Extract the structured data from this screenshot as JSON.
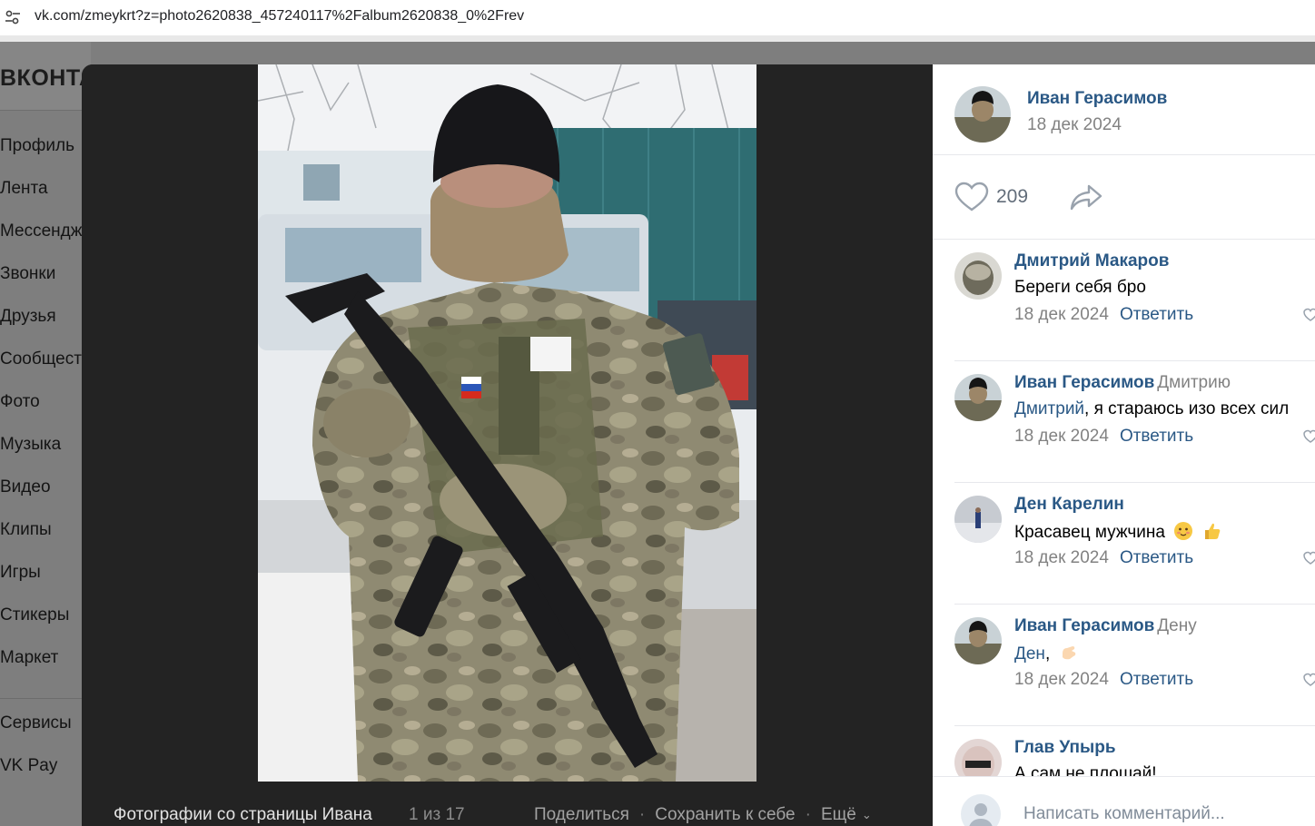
{
  "browser": {
    "url": "vk.com/zmeykrt?z=photo2620838_457240117%2Falbum2620838_0%2Frev",
    "site_icon": "tune-icon"
  },
  "vk": {
    "logo": "ВКОНТАКТЕ",
    "nav": [
      "Профиль",
      "Лента",
      "Мессенджер",
      "Звонки",
      "Друзья",
      "Сообщества",
      "Фото",
      "Музыка",
      "Видео",
      "Клипы",
      "Игры",
      "Стикеры",
      "Маркет"
    ],
    "nav_bottom": [
      "Сервисы",
      "VK Pay"
    ]
  },
  "viewer": {
    "album_title": "Фотографии со страницы Ивана",
    "counter": "1 из 17",
    "share": "Поделиться",
    "save": "Сохранить к себе",
    "more": "Ещё"
  },
  "panel": {
    "author_name": "Иван Герасимов",
    "author_date": "18 дек 2024",
    "likes": "209",
    "reply_label": "Ответить",
    "comment_placeholder": "Написать комментарий..."
  },
  "comments": [
    {
      "author": "Дмитрий Макаров",
      "to": "",
      "mention": "",
      "text": "Береги себя бро",
      "date": "18 дек 2024"
    },
    {
      "author": "Иван Герасимов",
      "to": "Дмитрию",
      "mention": "Дмитрий",
      "text": ", я стараюсь изо всех сил",
      "date": "18 дек 2024"
    },
    {
      "author": "Ден Карелин",
      "to": "",
      "mention": "",
      "text": "Красавец мужчина",
      "date": "18 дек 2024"
    },
    {
      "author": "Иван Герасимов",
      "to": "Дену",
      "mention": "Ден",
      "text": ",",
      "date": "18 дек 2024"
    },
    {
      "author": "Глав Упырь",
      "to": "",
      "mention": "",
      "text": "А сам не плошай!",
      "date": ""
    }
  ],
  "colors": {
    "link": "#2a5885",
    "muted": "#828282",
    "viewer_bg": "#222222",
    "dim_page": "#7e7e7e"
  }
}
